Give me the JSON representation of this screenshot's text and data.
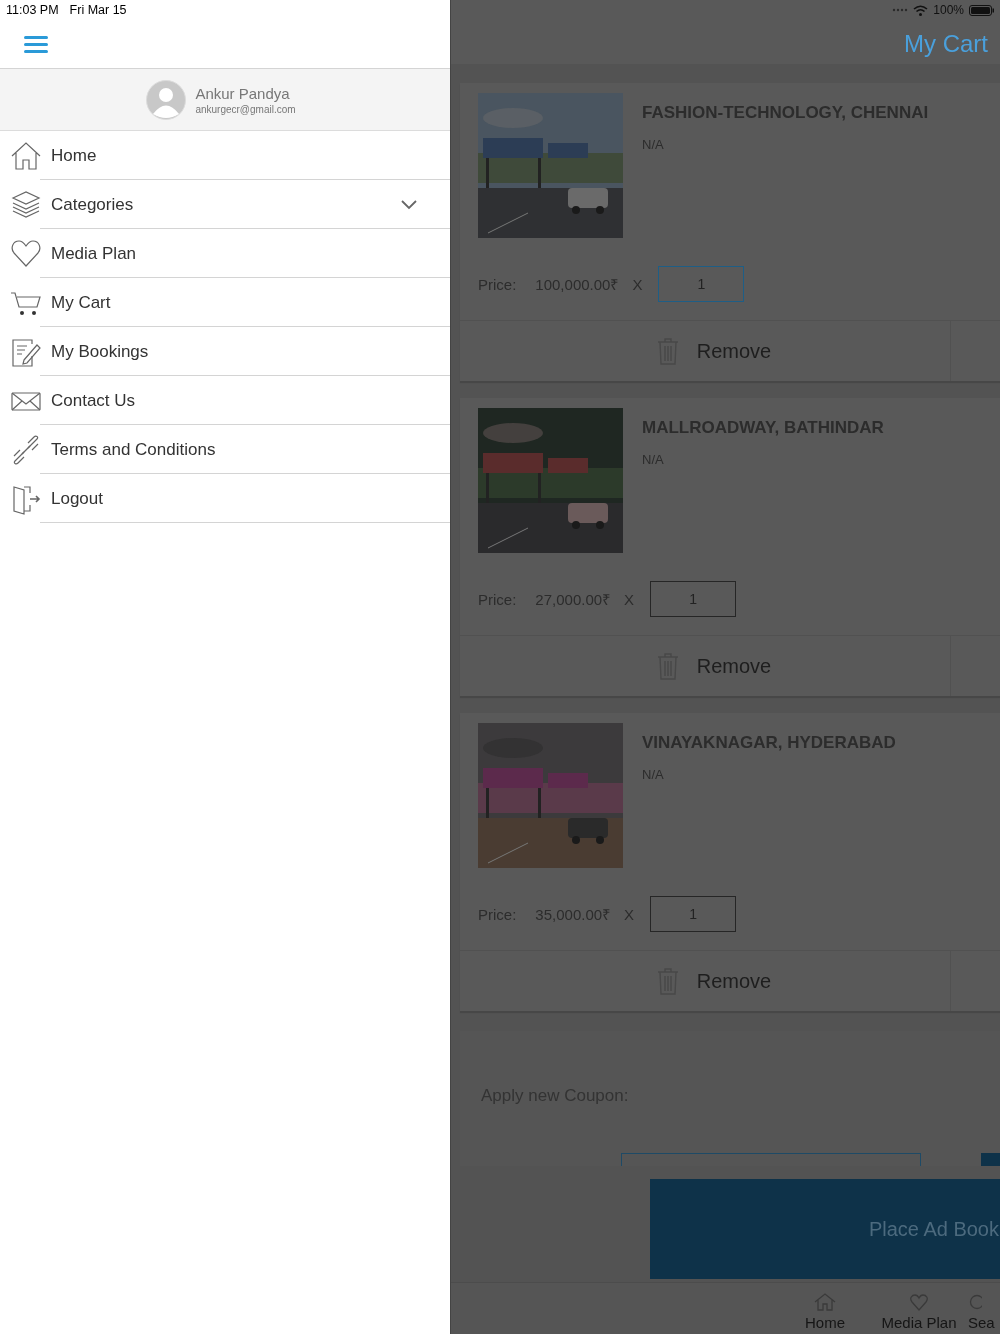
{
  "status_bar": {
    "time": "11:03 PM",
    "date": "Fri Mar 15",
    "battery": "100%"
  },
  "drawer": {
    "user": {
      "name": "Ankur Pandya",
      "email": "ankurgecr@gmail.com"
    },
    "items": [
      {
        "label": "Home",
        "expandable": false
      },
      {
        "label": "Categories",
        "expandable": true
      },
      {
        "label": "Media Plan",
        "expandable": false
      },
      {
        "label": "My Cart",
        "expandable": false
      },
      {
        "label": "My Bookings",
        "expandable": false
      },
      {
        "label": "Contact Us",
        "expandable": false
      },
      {
        "label": "Terms and Conditions",
        "expandable": false
      },
      {
        "label": "Logout",
        "expandable": false
      }
    ]
  },
  "cart": {
    "title": "My Cart",
    "items": [
      {
        "title": "FASHION-TECHNOLOGY, CHENNAI",
        "subtitle": "N/A",
        "price_label": "Price:",
        "price": "100,000.00₹",
        "times": "X",
        "quantity": "1",
        "focused": true,
        "remove": "Remove"
      },
      {
        "title": "MALLROADWAY, BATHINDAR",
        "subtitle": "N/A",
        "price_label": "Price:",
        "price": "27,000.00₹",
        "times": "X",
        "quantity": "1",
        "focused": false,
        "remove": "Remove"
      },
      {
        "title": "VINAYAKNAGAR, HYDERABAD",
        "subtitle": "N/A",
        "price_label": "Price:",
        "price": "35,000.00₹",
        "times": "X",
        "quantity": "1",
        "focused": false,
        "remove": "Remove"
      }
    ],
    "coupon_label": "Apply new Coupon:",
    "place_button": "Place Ad Book",
    "tabs": [
      {
        "label": "Home"
      },
      {
        "label": "Media Plan"
      },
      {
        "label": "Sea"
      }
    ]
  }
}
